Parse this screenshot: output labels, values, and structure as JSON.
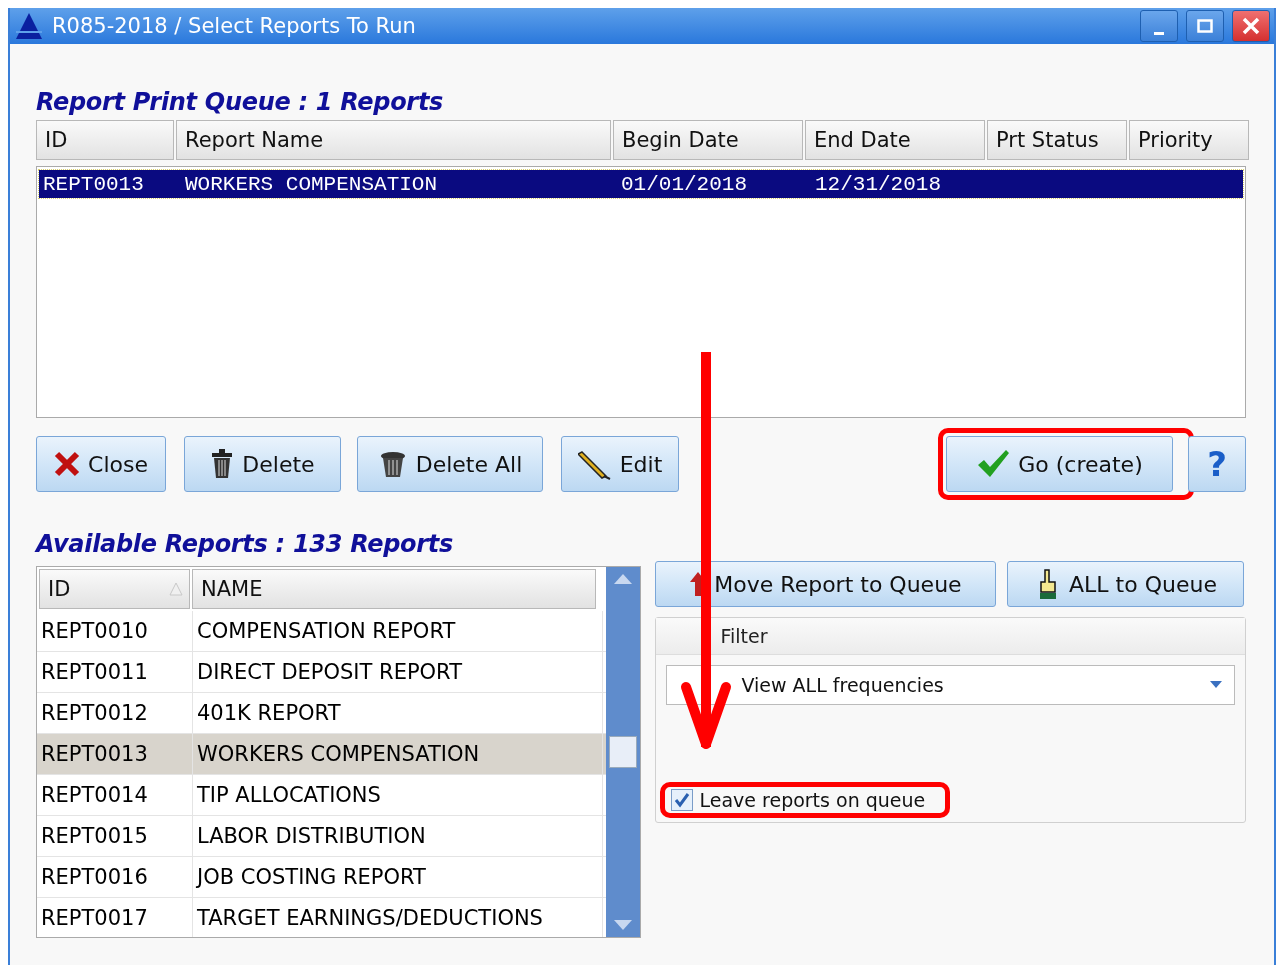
{
  "window": {
    "title": "R085-2018 / Select Reports To Run"
  },
  "queue": {
    "title": "Report Print Queue : 1 Reports",
    "columns": [
      "ID",
      "Report Name",
      "Begin Date",
      "End Date",
      "Prt Status",
      "Priority"
    ],
    "rows": [
      {
        "cells": [
          "REPT0013",
          "WORKERS COMPENSATION",
          "01/01/2018",
          "12/31/2018",
          "",
          ""
        ],
        "selected": true
      }
    ]
  },
  "queue_buttons": [
    {
      "kind": "close",
      "label": "Close",
      "highlighted": false
    },
    {
      "kind": "delete",
      "label": "Delete",
      "highlighted": false
    },
    {
      "kind": "delete_all",
      "label": "Delete All",
      "highlighted": false
    },
    {
      "kind": "edit",
      "label": "Edit",
      "highlighted": false
    },
    {
      "kind": "go",
      "label": "Go (create)",
      "highlighted": true
    }
  ],
  "help_button": {
    "label": "?"
  },
  "available": {
    "title": "Available Reports : 133 Reports",
    "columns": [
      {
        "label": "ID",
        "sorted": true
      },
      {
        "label": "NAME",
        "sorted": false
      }
    ],
    "rows": [
      {
        "cells": [
          "REPT0010",
          "COMPENSATION REPORT"
        ],
        "selected": false
      },
      {
        "cells": [
          "REPT0011",
          "DIRECT DEPOSIT REPORT"
        ],
        "selected": false
      },
      {
        "cells": [
          "REPT0012",
          "401K REPORT"
        ],
        "selected": false
      },
      {
        "cells": [
          "REPT0013",
          "WORKERS COMPENSATION"
        ],
        "selected": true
      },
      {
        "cells": [
          "REPT0014",
          "TIP ALLOCATIONS"
        ],
        "selected": false
      },
      {
        "cells": [
          "REPT0015",
          "LABOR DISTRIBUTION"
        ],
        "selected": false
      },
      {
        "cells": [
          "REPT0016",
          "JOB COSTING REPORT"
        ],
        "selected": false
      },
      {
        "cells": [
          "REPT0017",
          "TARGET EARNINGS/DEDUCTIONS"
        ],
        "selected": false
      }
    ]
  },
  "move_buttons": [
    {
      "kind": "move",
      "label": "Move Report to Queue"
    },
    {
      "kind": "all",
      "label": "ALL to Queue"
    }
  ],
  "filter": {
    "title": "Filter",
    "value": "View ALL frequencies"
  },
  "leave_on_queue": {
    "label": "Leave reports on queue",
    "checked": true,
    "highlighted": true
  }
}
